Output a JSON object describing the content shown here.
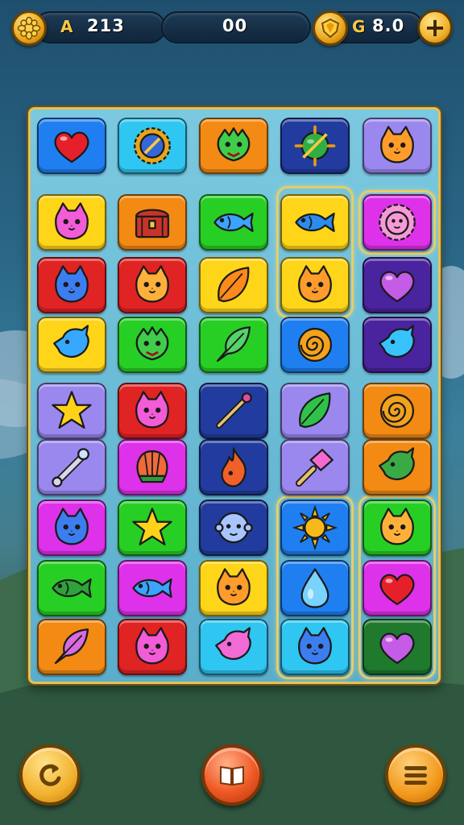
{
  "hud": {
    "left_glyph": "A",
    "score": "213",
    "center_value": "00",
    "right_glyph": "G",
    "currency": "8.0",
    "add_label": "+"
  },
  "colors": {
    "blue": "#1f7ff0",
    "cyan": "#2fc6f2",
    "orange": "#f28a14",
    "navy": "#213c9e",
    "lavender": "#9a88ef",
    "yellow": "#ffd51a",
    "green": "#27cf25",
    "magenta": "#dd32ea",
    "red": "#e02323",
    "purple": "#4a239e",
    "dkgreen": "#1f7a2e",
    "gold": "#e2c25a"
  },
  "board": {
    "tiles": [
      {
        "bg": "blue",
        "icon": "heart-icon"
      },
      {
        "bg": "cyan",
        "icon": "sun-compass-icon"
      },
      {
        "bg": "orange",
        "icon": "dragon-icon"
      },
      {
        "bg": "navy",
        "icon": "orb-icon"
      },
      {
        "bg": "lavender",
        "icon": "cat-icon"
      },
      {
        "bg": "yellow",
        "icon": "cat-icon"
      },
      {
        "bg": "orange",
        "icon": "chest-icon"
      },
      {
        "bg": "green",
        "icon": "fish-icon"
      },
      {
        "bg": "yellow",
        "icon": "fish-icon"
      },
      {
        "bg": "magenta",
        "icon": "lion-icon"
      },
      {
        "bg": "red",
        "icon": "cat-icon"
      },
      {
        "bg": "red",
        "icon": "cat-icon"
      },
      {
        "bg": "yellow",
        "icon": "leaf-icon"
      },
      {
        "bg": "yellow",
        "icon": "cat-icon"
      },
      {
        "bg": "purple",
        "icon": "heart-icon"
      },
      {
        "bg": "yellow",
        "icon": "bird-icon"
      },
      {
        "bg": "green",
        "icon": "dragon-icon"
      },
      {
        "bg": "green",
        "icon": "feather-icon"
      },
      {
        "bg": "blue",
        "icon": "swirl-icon"
      },
      {
        "bg": "purple",
        "icon": "bird-icon"
      },
      {
        "bg": "lavender",
        "icon": "star-icon"
      },
      {
        "bg": "red",
        "icon": "cat-icon"
      },
      {
        "bg": "navy",
        "icon": "wand-icon"
      },
      {
        "bg": "lavender",
        "icon": "leaf-icon"
      },
      {
        "bg": "orange",
        "icon": "swirl-icon"
      },
      {
        "bg": "lavender",
        "icon": "bone-icon"
      },
      {
        "bg": "magenta",
        "icon": "shell-icon"
      },
      {
        "bg": "navy",
        "icon": "flame-icon"
      },
      {
        "bg": "lavender",
        "icon": "hammer-icon"
      },
      {
        "bg": "orange",
        "icon": "bird-icon"
      },
      {
        "bg": "magenta",
        "icon": "cat-icon"
      },
      {
        "bg": "green",
        "icon": "star-icon"
      },
      {
        "bg": "navy",
        "icon": "ghost-icon"
      },
      {
        "bg": "blue",
        "icon": "sun-icon"
      },
      {
        "bg": "green",
        "icon": "cat-icon"
      },
      {
        "bg": "green",
        "icon": "fish-icon"
      },
      {
        "bg": "magenta",
        "icon": "fish-icon"
      },
      {
        "bg": "yellow",
        "icon": "cat-icon"
      },
      {
        "bg": "blue",
        "icon": "drop-icon"
      },
      {
        "bg": "magenta",
        "icon": "heart-icon"
      },
      {
        "bg": "orange",
        "icon": "feather-icon"
      },
      {
        "bg": "red",
        "icon": "cat-icon"
      },
      {
        "bg": "cyan",
        "icon": "bird-icon"
      },
      {
        "bg": "cyan",
        "icon": "cat-icon"
      },
      {
        "bg": "dkgreen",
        "icon": "heart-icon"
      }
    ]
  },
  "buttons": {
    "undo": "undo-icon",
    "hint": "book-icon",
    "menu": "menu-icon"
  }
}
